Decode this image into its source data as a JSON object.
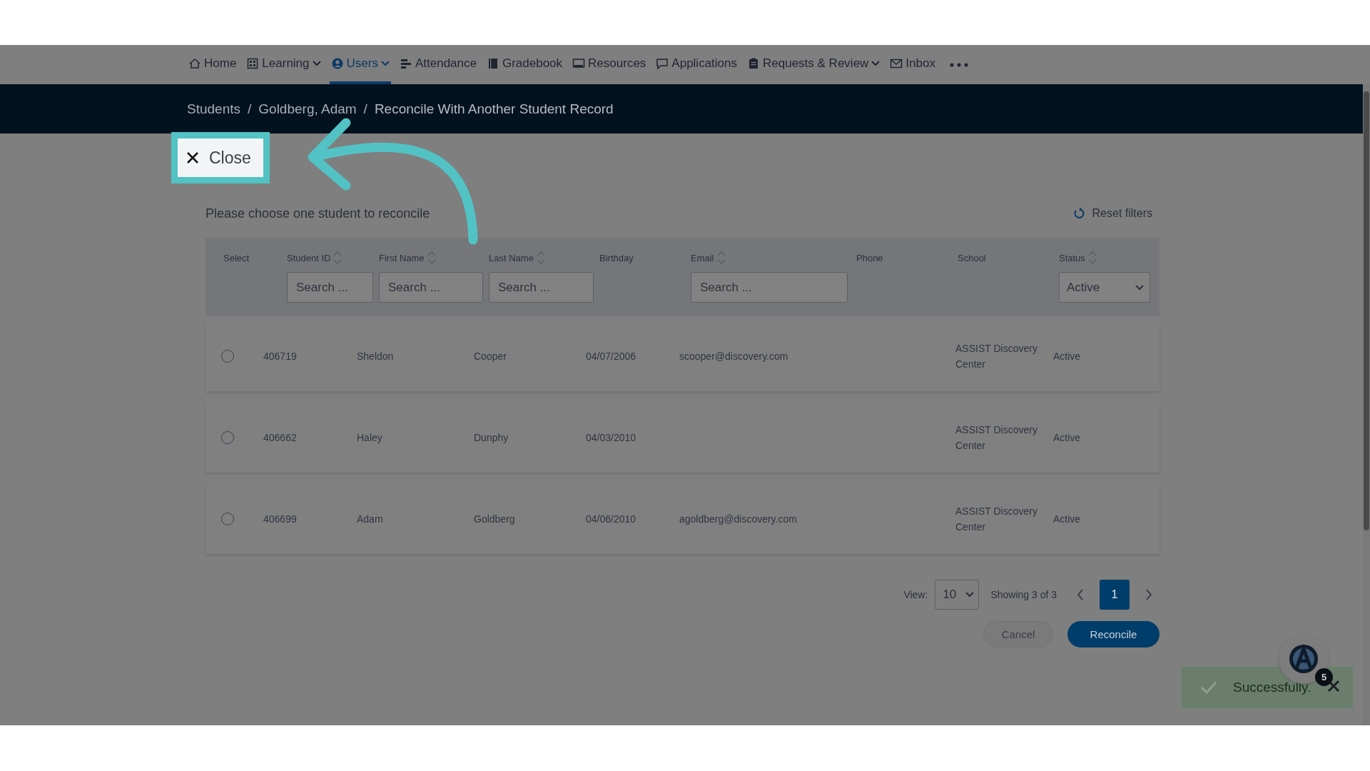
{
  "nav": {
    "items": [
      {
        "label": "Home",
        "kind": "home",
        "selected": false,
        "dropdown": false
      },
      {
        "label": "Learning",
        "kind": "grid",
        "selected": false,
        "dropdown": true
      },
      {
        "label": "Users",
        "kind": "user",
        "selected": true,
        "dropdown": true
      },
      {
        "label": "Attendance",
        "kind": "bars",
        "selected": false,
        "dropdown": false
      },
      {
        "label": "Gradebook",
        "kind": "book",
        "selected": false,
        "dropdown": false
      },
      {
        "label": "Resources",
        "kind": "monitor",
        "selected": false,
        "dropdown": false
      },
      {
        "label": "Applications",
        "kind": "chat",
        "selected": false,
        "dropdown": false
      },
      {
        "label": "Requests & Review",
        "kind": "clipboard",
        "selected": false,
        "dropdown": true
      },
      {
        "label": "Inbox",
        "kind": "mail",
        "selected": false,
        "dropdown": false
      }
    ]
  },
  "breadcrumb": [
    {
      "label": "Students"
    },
    {
      "separator": "/",
      "label": "Goldberg, Adam"
    },
    {
      "separator": "/",
      "label": "Reconcile With Another Student Record"
    }
  ],
  "close_button": {
    "label": "Close"
  },
  "instruction": "Please choose one student to reconcile",
  "reset_filters": "Reset filters",
  "table": {
    "columns": [
      {
        "label": "Select",
        "sortable": false,
        "kind": "plain"
      },
      {
        "label": "Student ID",
        "sortable": true,
        "kind": "search",
        "placeholder": "Search ..."
      },
      {
        "label": "First Name",
        "sortable": true,
        "kind": "search",
        "placeholder": "Search ..."
      },
      {
        "label": "Last Name",
        "sortable": true,
        "kind": "search",
        "placeholder": "Search ..."
      },
      {
        "label": "Birthday",
        "sortable": false,
        "kind": "plain"
      },
      {
        "label": "Email",
        "sortable": true,
        "kind": "search",
        "placeholder": "Search ..."
      },
      {
        "label": "Phone",
        "sortable": false,
        "kind": "plain"
      },
      {
        "label": "School",
        "sortable": false,
        "kind": "plain"
      },
      {
        "label": "Status",
        "sortable": true,
        "kind": "select",
        "value": "Active"
      }
    ],
    "rows": [
      {
        "selected": false,
        "student_id": "406719",
        "first_name": "Sheldon",
        "last_name": "Cooper",
        "birthday": "04/07/2006",
        "email": "scooper@discovery.com",
        "school": "ASSIST Discovery Center",
        "status": "Active"
      },
      {
        "selected": false,
        "student_id": "406662",
        "first_name": "Haley",
        "last_name": "Dunphy",
        "birthday": "04/03/2010",
        "school": "ASSIST Discovery Center",
        "status": "Active"
      },
      {
        "selected": false,
        "student_id": "406699",
        "first_name": "Adam",
        "last_name": "Goldberg",
        "birthday": "04/06/2010",
        "email": "agoldberg@discovery.com",
        "school": "ASSIST Discovery Center",
        "status": "Active"
      }
    ]
  },
  "pagination": {
    "view_label": "View:",
    "page_size": "10",
    "showing": "Showing 3 of 3",
    "pages": [
      {
        "label": "1",
        "selected": true
      }
    ]
  },
  "buttons": [
    {
      "label": "Cancel",
      "kind": "secondary"
    },
    {
      "label": "Reconcile",
      "kind": "primary"
    }
  ],
  "toast": {
    "message": "Successfully."
  },
  "help_badge": "5"
}
